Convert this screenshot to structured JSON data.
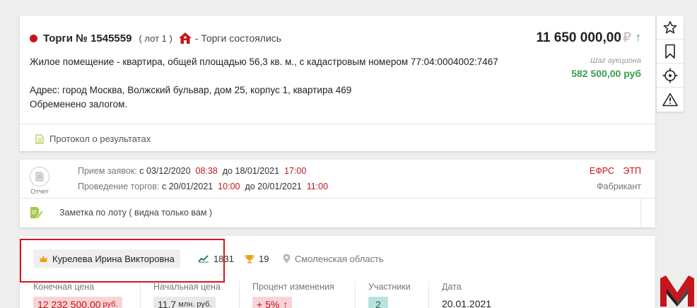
{
  "lot": {
    "title": "Торги № 1545559",
    "lot_label": "( лот 1 )",
    "status": "- Торги состоялись",
    "price": "11 650 000,00",
    "currency_symbol": "₽",
    "price_trend_icon": "arrow-up-icon",
    "description": "Жилое помещение - квартира, общей площадью 56,3 кв. м., с кадастровым номером 77:04:0004002:7467",
    "address": "Адрес: город Москва, Волжский бульвар, дом 25, корпус 1, квартира 469",
    "encumbrance": "Обременено залогом.",
    "step_label": "Шаг аукциона",
    "step_value": "582 500,00 руб",
    "protocol_link": "Протокол о результатах"
  },
  "toolbar": {
    "icons": [
      "star-icon",
      "bookmark-icon",
      "target-icon",
      "warning-icon"
    ]
  },
  "schedule": {
    "report_label": "Отчет",
    "applications_label": "Прием заявок:",
    "applications_from_word": "с",
    "applications_from_date": "03/12/2020",
    "applications_from_time": "08:38",
    "applications_to_word": "до",
    "applications_to_date": "18/01/2021",
    "applications_to_time": "17:00",
    "auction_label": "Проведение торгов:",
    "auction_from_word": "с",
    "auction_from_date": "20/01/2021",
    "auction_from_time": "10:00",
    "auction_to_word": "до",
    "auction_to_date": "20/01/2021",
    "auction_to_time": "11:00",
    "efrs_link": "ЕФРС",
    "etp_link": "ЭТП",
    "platform": "Фабрикант",
    "note_placeholder": "Заметка по лоту ( видна только вам )"
  },
  "stats": {
    "winner_name": "Курелева  Ирина  Викторовна",
    "rating": "1831",
    "wins": "19",
    "region": "Смоленская область",
    "columns": {
      "final_price_label": "Конечная цена",
      "final_price_value": "12 232 500,00",
      "final_price_unit": "руб.",
      "start_price_label": "Начальная цена",
      "start_price_value": "11,7",
      "start_price_unit": "млн. руб.",
      "change_label": "Процент изменения",
      "change_value": "+ 5%",
      "participants_label": "Участники",
      "participants_value": "2",
      "date_label": "Дата",
      "date_value": "20.01.2021"
    }
  },
  "colors": {
    "accent_red": "#c4161c",
    "accent_green": "#3b9e4d",
    "highlight_box": "#d6141f"
  }
}
